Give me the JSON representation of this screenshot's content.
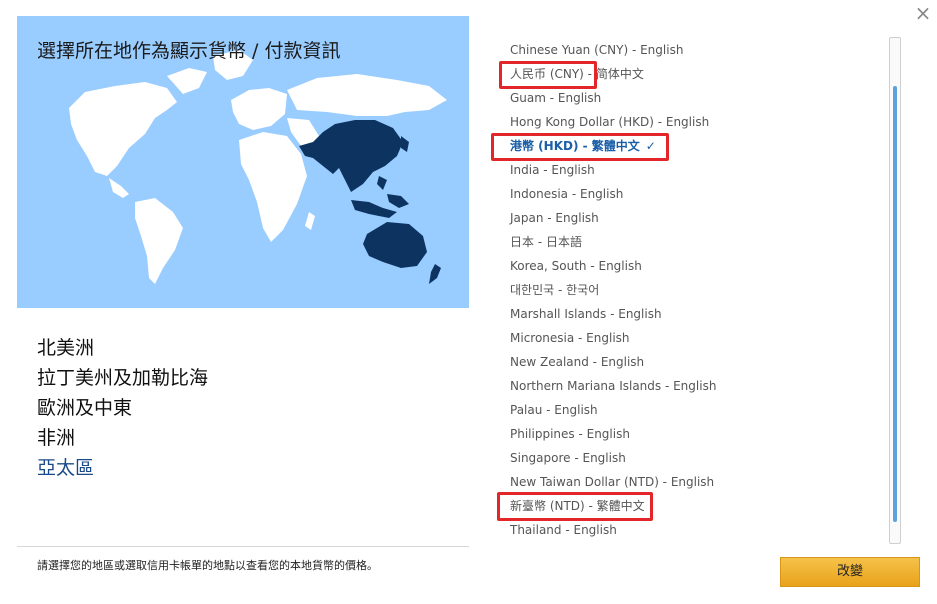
{
  "dialog": {
    "close_label": "×",
    "map_title": "選擇所在地作為顯示貨幣 / 付款資訊",
    "footer_note": "請選擇您的地區或選取信用卡帳單的地點以查看您的本地貨幣的價格。",
    "submit_label": "改變"
  },
  "regions": [
    {
      "label": "北美洲",
      "active": false
    },
    {
      "label": "拉丁美州及加勒比海",
      "active": false
    },
    {
      "label": "歐洲及中東",
      "active": false
    },
    {
      "label": "非洲",
      "active": false
    },
    {
      "label": "亞太區",
      "active": true
    }
  ],
  "locales": [
    {
      "label": "Chinese Yuan (CNY) - English"
    },
    {
      "label": "人民币 (CNY) - 简体中文",
      "highlighted": true
    },
    {
      "label": "Guam - English"
    },
    {
      "label": "Hong Kong Dollar (HKD) - English"
    },
    {
      "label": "港幣 (HKD) - 繁體中文",
      "selected": true,
      "highlighted": true
    },
    {
      "label": "India - English"
    },
    {
      "label": "Indonesia - English"
    },
    {
      "label": "Japan - English"
    },
    {
      "label": "日本 - 日本語"
    },
    {
      "label": "Korea, South - English"
    },
    {
      "label": "대한민국 - 한국어"
    },
    {
      "label": "Marshall Islands - English"
    },
    {
      "label": "Micronesia - English"
    },
    {
      "label": "New Zealand - English"
    },
    {
      "label": "Northern Mariana Islands - English"
    },
    {
      "label": "Palau - English"
    },
    {
      "label": "Philippines - English"
    },
    {
      "label": "Singapore - English"
    },
    {
      "label": "New Taiwan Dollar (NTD) - English"
    },
    {
      "label": "新臺幣 (NTD) - 繁體中文",
      "highlighted": true
    },
    {
      "label": "Thailand - English"
    }
  ],
  "icons": {
    "selected_check": "checkmark-icon",
    "close": "close-icon"
  },
  "colors": {
    "map_background": "#99ccff",
    "highlight_region": "#0d3461",
    "active_region_text": "#1b4a8a",
    "selected_text": "#1b5fa8",
    "annotation_box": "#e3262a",
    "button_gold": "#e8a21a"
  }
}
